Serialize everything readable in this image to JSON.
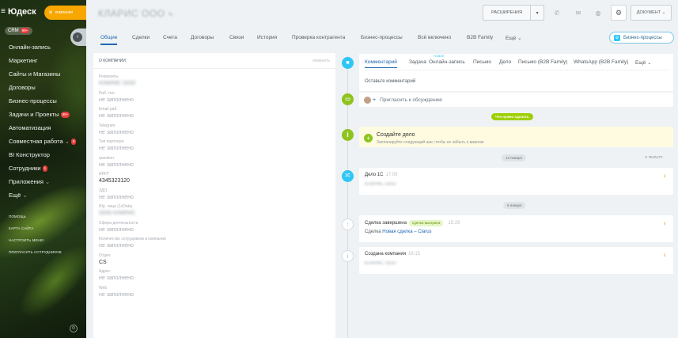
{
  "sidebar": {
    "logo": "Юдеск",
    "company_button": "компания",
    "crm_label": "CRM",
    "crm_count": "99+",
    "items": [
      {
        "label": "Онлайн-запись",
        "badge": ""
      },
      {
        "label": "Маркетинг",
        "badge": ""
      },
      {
        "label": "Сайты и Магазины",
        "badge": ""
      },
      {
        "label": "Договоры",
        "badge": ""
      },
      {
        "label": "Бизнес-процессы",
        "badge": ""
      },
      {
        "label": "Задачи и Проекты",
        "badge": "99+"
      },
      {
        "label": "Автоматизация",
        "badge": ""
      },
      {
        "label": "Совместная работа",
        "badge": "9"
      },
      {
        "label": "BI Конструктор",
        "badge": ""
      },
      {
        "label": "Сотрудники",
        "badge": "1"
      },
      {
        "label": "Приложения",
        "badge": ""
      },
      {
        "label": "Ещё",
        "badge": ""
      }
    ],
    "bottom": [
      "Помощь",
      "Карта сайта",
      "Настроить меню",
      "Пригласить сотрудников"
    ]
  },
  "header": {
    "title": "КЛАРИС ООО",
    "extensions_label": "РАСШИРЕНИЯ",
    "document_label": "ДОКУМЕНТ"
  },
  "tabs": [
    "Общие",
    "Сделки",
    "Счета",
    "Договоры",
    "Связи",
    "История",
    "Проверка контрагента",
    "Бизнес-процессы",
    "Всё включено",
    "B2B Family",
    "Ещё"
  ],
  "bp_button": "Бизнес-процессы",
  "about": {
    "heading": "О КОМПАНИИ",
    "edit": "изменить",
    "fields": [
      {
        "label": "Реквизиты",
        "value": "КЛАРИС ООО",
        "style": "blur"
      },
      {
        "label": "Раб. тел.",
        "value": "не заполнено",
        "style": ""
      },
      {
        "label": "Email раб.",
        "value": "не заполнено",
        "style": ""
      },
      {
        "label": "Telegram",
        "value": "не заполнено",
        "style": ""
      },
      {
        "label": "Тип партнера",
        "value": "не заполнено",
        "style": ""
      },
      {
        "label": "question",
        "value": "не заполнено",
        "style": ""
      },
      {
        "label": "ИНН*",
        "value": "4345323120",
        "style": "dark"
      },
      {
        "label": "ЗДО",
        "value": "не заполнено",
        "style": ""
      },
      {
        "label": "Юр. лицо (1sData)",
        "value": "ООО КЛАРИС",
        "style": "blur"
      },
      {
        "label": "Сфера деятельности",
        "value": "не заполнено",
        "style": ""
      },
      {
        "label": "Количество сотрудников в компании",
        "value": "не заполнено",
        "style": ""
      },
      {
        "label": "Отдел",
        "value": "CS",
        "style": "dark"
      },
      {
        "label": "Адрес",
        "value": "не заполнено",
        "style": ""
      },
      {
        "label": "Web",
        "value": "не заполнено",
        "style": ""
      }
    ]
  },
  "editor": {
    "tabs": [
      "Комментарий",
      "Задача",
      "Онлайн-запись",
      "Письмо",
      "Дело",
      "Письмо (B2B Family)",
      "WhatsApp (B2B Family)",
      "Ещё"
    ],
    "new_label": "новое",
    "placeholder": "Оставьте комментарий"
  },
  "invite": "Пригласить к обсуждению",
  "todo_pill": "Что нужно сделать",
  "todo": {
    "title": "Создайте дело",
    "hint": "Запланируйте следующий шаг, чтобы не забыть о важном"
  },
  "date1": "13 января",
  "filter": "Фильтр",
  "event1": {
    "title": "Дело 1С",
    "time": "17:05",
    "sub": "КЛАРИС ООО"
  },
  "date2": "9 января",
  "event2": {
    "title": "Сделка завершена",
    "tag": "сделка выиграна",
    "time": "15:29",
    "sub_prefix": "Сделка",
    "link": "Новая сделка – Clarus"
  },
  "event3": {
    "title": "Создана компания",
    "time": "16:15",
    "sub": "КЛАРИС ООО"
  },
  "colors": {
    "accent": "#2067b0",
    "brand_orange": "#f7a700",
    "success": "#9dcf00",
    "bp_blue": "#2fc6f6"
  }
}
